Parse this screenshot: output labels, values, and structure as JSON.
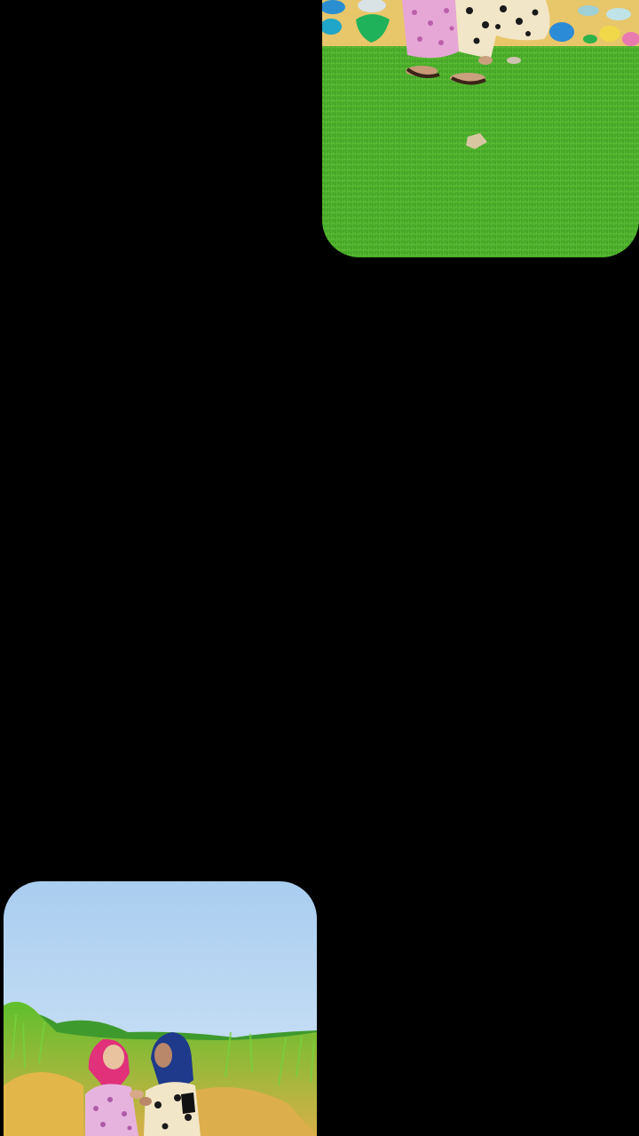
{
  "screen": {
    "background_color": "#000000"
  },
  "tiles": [
    {
      "subject": "grass-lawn-with-feet-and-painted-wall",
      "dominant_colors": [
        "#3fa52a",
        "#6cc83c",
        "#e9c56a"
      ]
    },
    {
      "subject": "two-women-in-headscarves-in-grass-field",
      "dominant_colors": [
        "#bcd9f2",
        "#7ecb3a",
        "#e3b64a",
        "#e0317a",
        "#1f3a8a"
      ]
    }
  ]
}
